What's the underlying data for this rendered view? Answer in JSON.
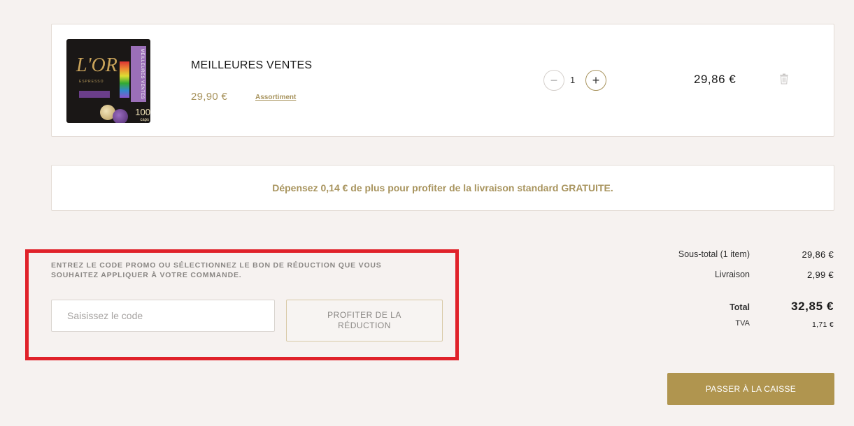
{
  "cart_item": {
    "image_alt": "L'OR Espresso Meilleures Ventes 100 caps",
    "image_logo": "L'OR",
    "image_side_text": "MEILLEURES VENTES",
    "image_sub_text": "ESPRESSO",
    "image_count": "100",
    "image_caps": "caps",
    "name": "MEILLEURES VENTES",
    "unit_price": "29,90 €",
    "link": "Assortiment",
    "qty_minus": "−",
    "qty": "1",
    "qty_plus": "+",
    "line_total": "29,86 €"
  },
  "shipping_banner": "Dépensez 0,14 € de plus pour profiter de la livraison standard GRATUITE.",
  "promo": {
    "instructions": "ENTREZ LE CODE PROMO OU SÉLECTIONNEZ LE BON DE RÉDUCTION QUE VOUS SOUHAITEZ APPLIQUER À VOTRE COMMANDE.",
    "input_placeholder": "Saisissez le code",
    "input_value": "",
    "button_label": "PROFITER DE LA RÉDUCTION"
  },
  "summary": {
    "subtotal_label": "Sous-total (1 item)",
    "subtotal_value": "29,86 €",
    "shipping_label": "Livraison",
    "shipping_value": "2,99 €",
    "total_label": "Total",
    "total_value": "32,85 €",
    "tax_label": "TVA",
    "tax_value": "1,71 €"
  },
  "checkout_label": "PASSER À LA CAISSE",
  "colors": {
    "accent_gold": "#a8945e",
    "button_gold": "#b0954f",
    "highlight_red": "#e0222a",
    "background": "#f6f2f0"
  },
  "icons": {
    "trash": "trash-icon",
    "minus": "minus-icon",
    "plus": "plus-icon"
  }
}
